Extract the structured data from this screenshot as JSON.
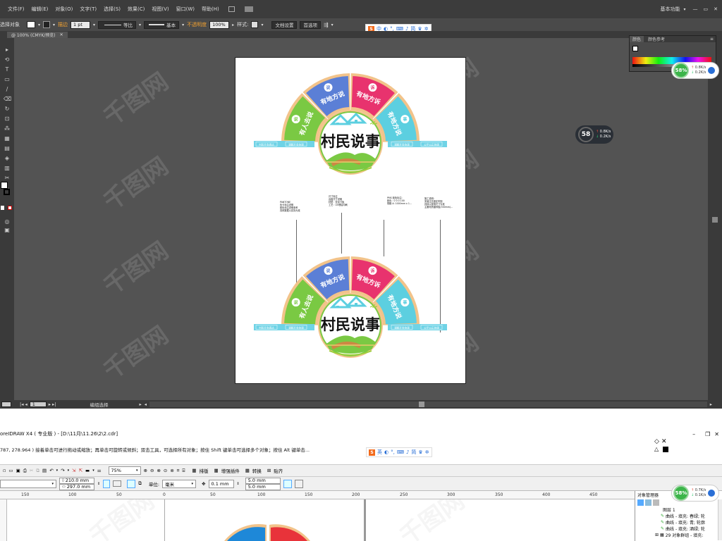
{
  "ai": {
    "menu": [
      "文件(F)",
      "编辑(E)",
      "对象(O)",
      "文字(T)",
      "选择(S)",
      "效果(C)",
      "视图(V)",
      "窗口(W)",
      "帮助(H)"
    ],
    "workspace": "基本功能",
    "control": {
      "selection_label": "选择对象",
      "stroke_label": "描边",
      "stroke_value": "1 pt",
      "profile_label": "等比",
      "brush_label": "基本",
      "opacity_label": "不透明度",
      "opacity_value": "100%",
      "style_label": "样式:",
      "doc_setup": "文档设置",
      "preferences": "首选项"
    },
    "tab_label": "@ 100% (CMYK/预览)",
    "status_zoom": "1",
    "status_text": "编组选择",
    "color_panel": {
      "tab1": "颜色",
      "tab2": "颜色参考"
    }
  },
  "ime": {
    "top_items": [
      "中",
      "简"
    ],
    "bottom_items": [
      "英",
      "简"
    ]
  },
  "speed_meters": [
    {
      "percent": "58%",
      "up": "0.8K/s",
      "down": "0.2K/s"
    },
    {
      "percent": "58",
      "up": "0.8K/s",
      "down": "0.2K/s"
    },
    {
      "percent": "58%",
      "up": "0.7K/s",
      "down": "0.1K/s"
    }
  ],
  "design": {
    "title": "村民说事",
    "segments": [
      "有人去说",
      "有地方说",
      "有地方诉",
      "有地方说"
    ],
    "segment_icons": [
      "说",
      "说",
      "诉",
      "事"
    ],
    "banner_left": [
      "村民开会表达",
      "调解开会协调"
    ],
    "banner_right": [
      "调解开会协调",
      "公平公正协调"
    ]
  },
  "callouts": [
    "PANTONE\n色卡标注说明\n颜色标注说明参考\n具体数据以实际为准",
    "尺寸标注\n高度尺寸说明\n材质：亚克力板\n工艺：UV喷绘印刷",
    "PMS 颜色标注:\n颜色：0 0 0 100\n规格 A: 1000mm x 1...",
    "施工说明:\n安装注意固定牢固\n具体以现场尺寸为准\n主要材质镀锌板(300mm)…"
  ],
  "cd": {
    "title": "oreIDRAW X4 ( 专业版 ) - [D:\\11月\\11.26\\2\\2.cdr]",
    "status": "787, 278.964 )    接着单击可进行拖动或缩放；再单击可旋转或倾斜；双击工具，可选择所有对象；按住 Shift 键单击可选择多个对象；按住 Alt 键单击...",
    "zoom": "75%",
    "toolbar_items": [
      "排版",
      "增强插件",
      "转换",
      "贴齐"
    ],
    "width": "210.0 mm",
    "height": "297.0 mm",
    "unit_label": "单位:",
    "unit": "毫米",
    "nudge": "0.1 mm",
    "dup_x": "5.0 mm",
    "dup_y": "5.0 mm",
    "ruler_ticks": [
      "150",
      "100",
      "50",
      "0",
      "50",
      "100",
      "150",
      "200",
      "250",
      "300",
      "350",
      "400",
      "450"
    ],
    "obj_manager_title": "对象管理器",
    "objects": [
      "图层 1",
      "曲线 - 填充: 春绿; 轮",
      "曲线 - 填充: 青; 轮廓",
      "曲线 - 填充: 酒绿; 轮",
      "29 对象群组 - 填充:"
    ]
  },
  "colors": {
    "orange_ring": "#f2c38a",
    "green": "#7ac943",
    "blue": "#5b7fd6",
    "pink": "#e8336e",
    "cyan": "#5ccfe0",
    "banner": "#6fd3e6"
  }
}
